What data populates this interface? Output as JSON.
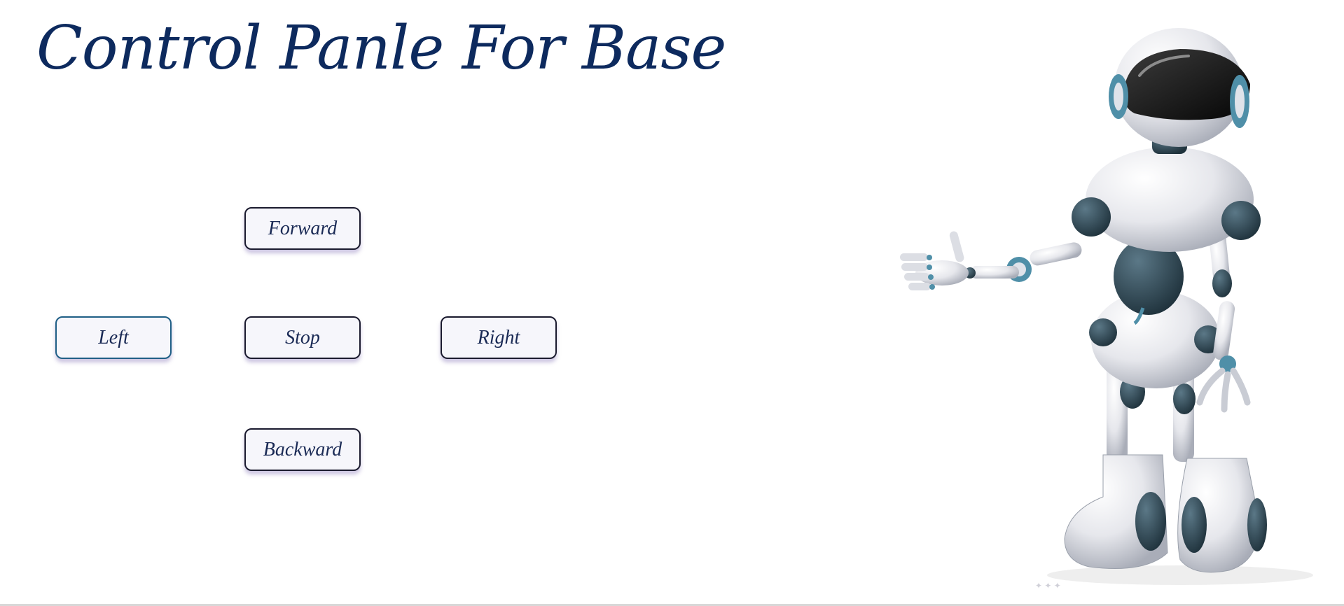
{
  "page": {
    "title": "Control Panle For Base"
  },
  "controls": {
    "forward": "Forward",
    "left": "Left",
    "stop": "Stop",
    "right": "Right",
    "backward": "Backward"
  },
  "robot": {
    "icon": "robot-illustration"
  },
  "colors": {
    "title": "#0d2a5e",
    "button_border": "#1a1a2e",
    "button_bg": "#f6f6fb",
    "robot_body": "#e8e9ee",
    "robot_joint": "#2f4a58",
    "robot_accent": "#4f8fa8"
  }
}
